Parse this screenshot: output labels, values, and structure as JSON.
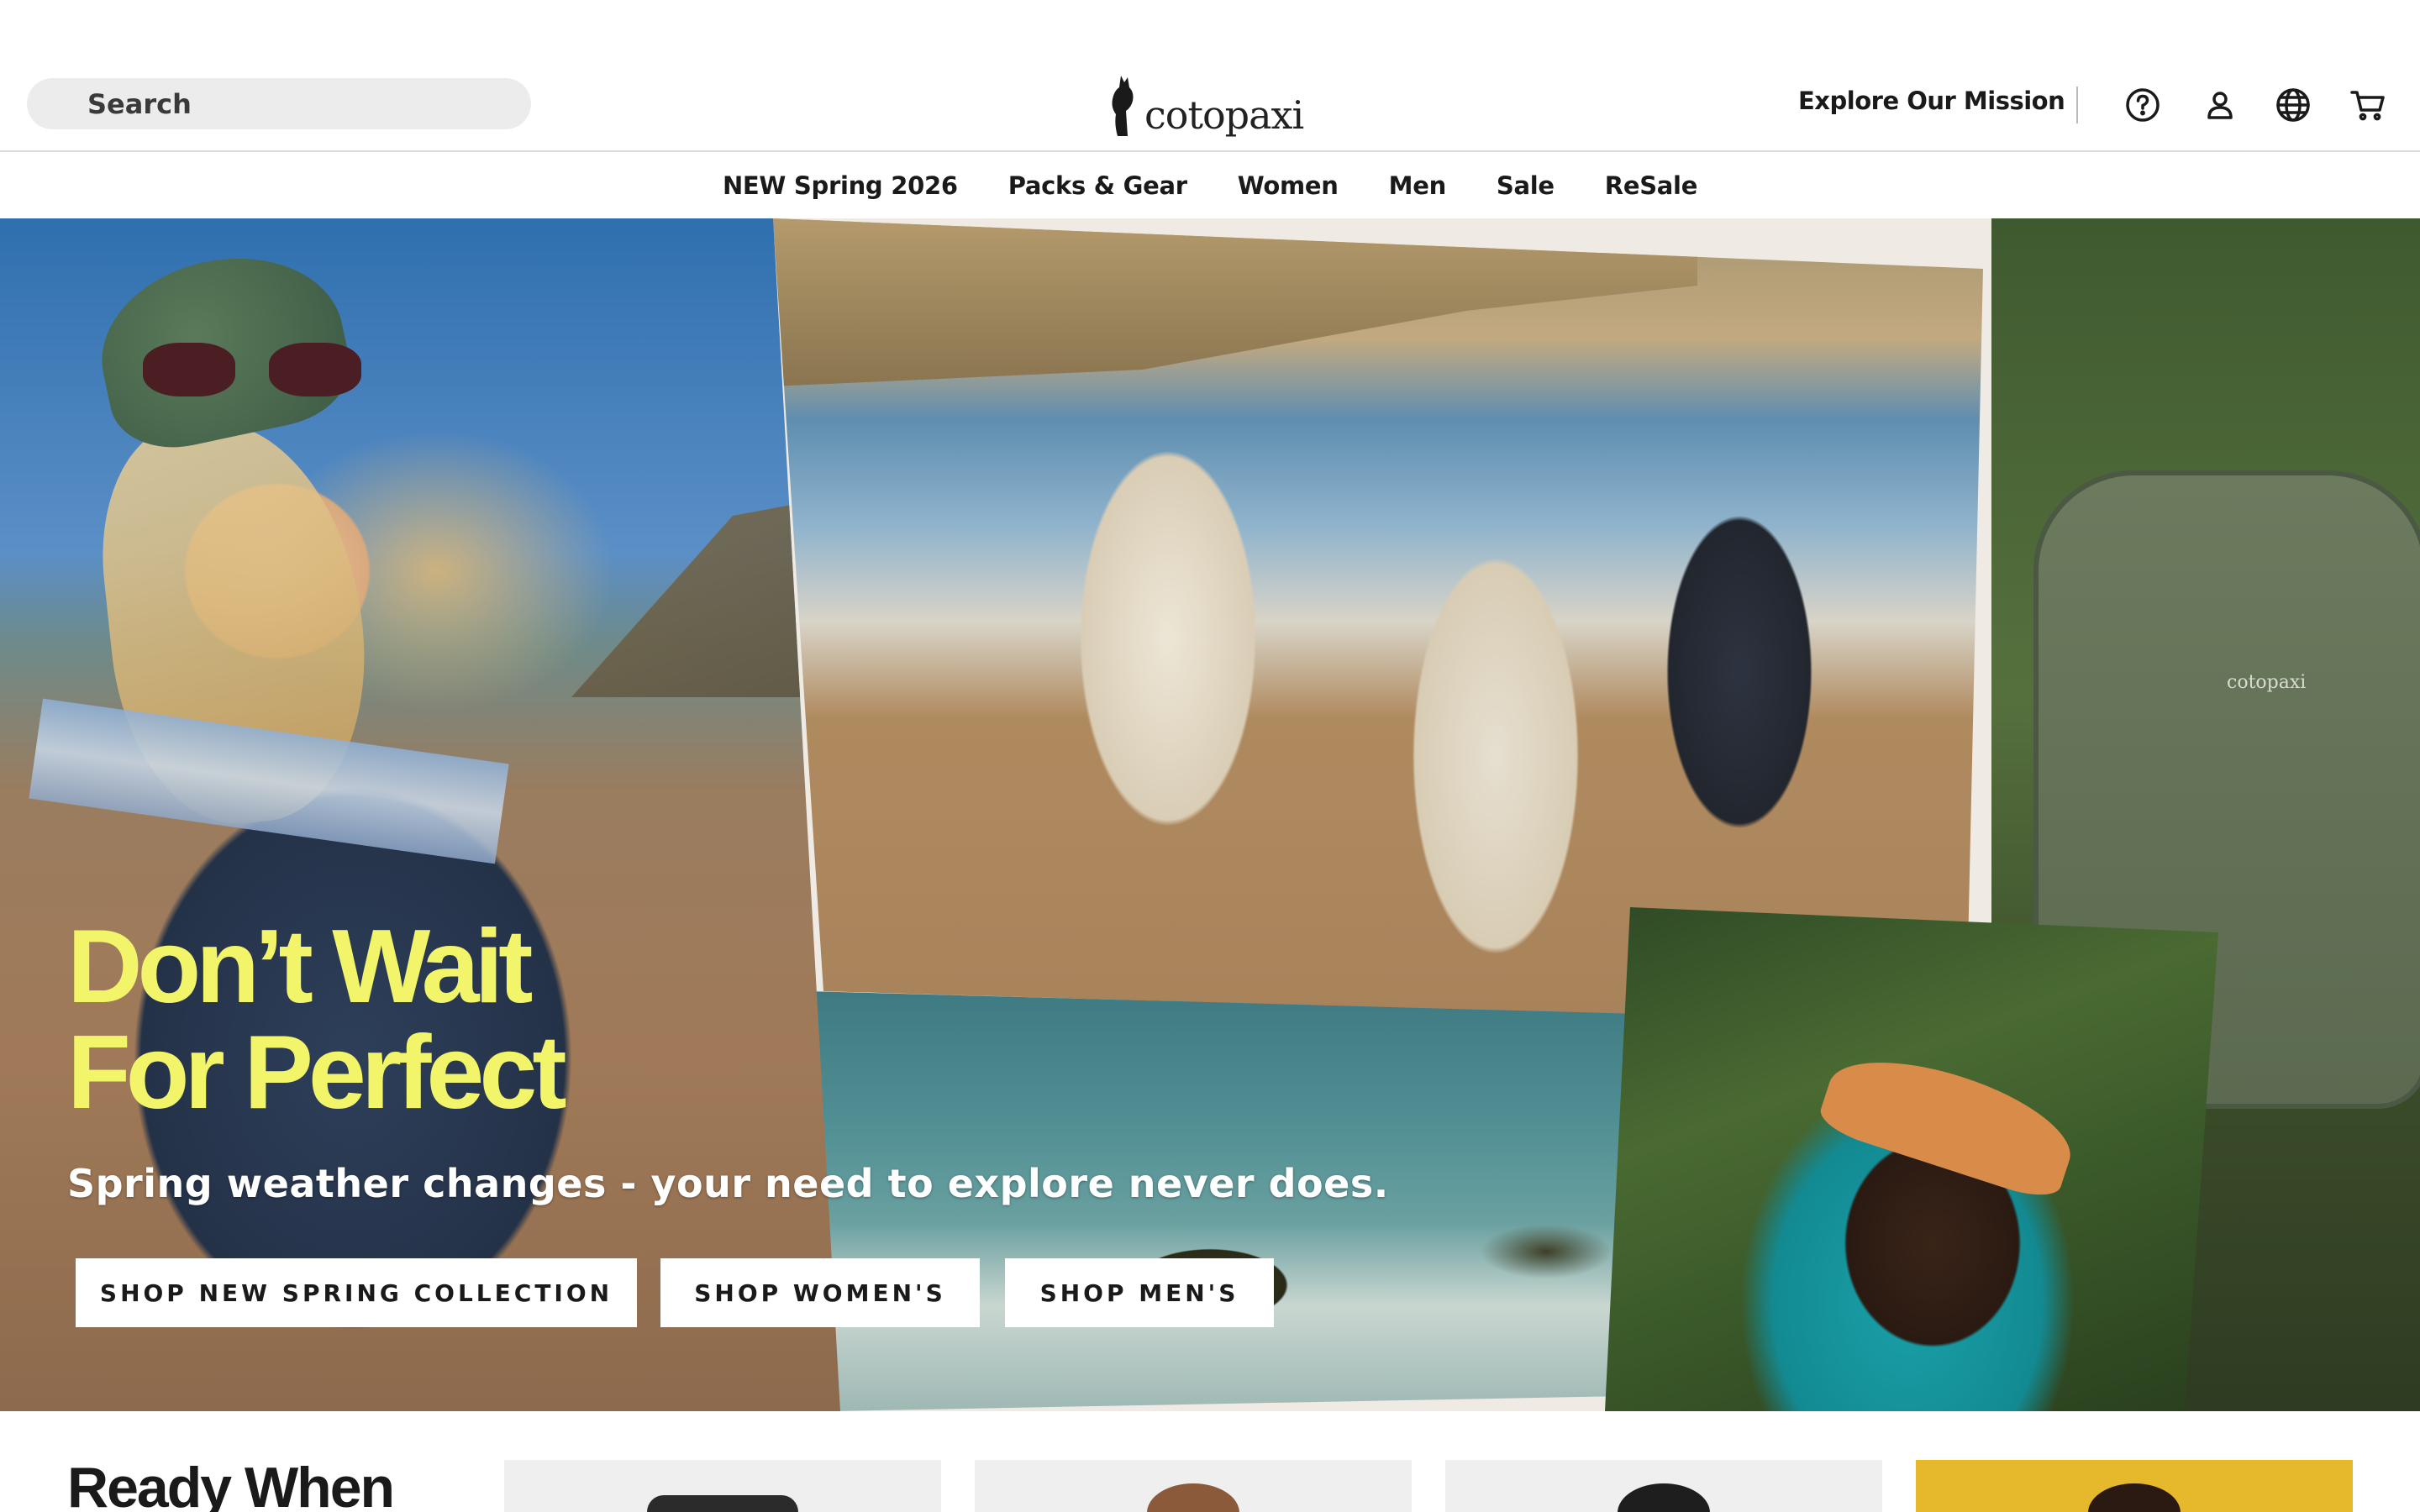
{
  "header": {
    "search_placeholder": "Search",
    "logo_text": "cotopaxi",
    "mission_link": "Explore Our Mission",
    "icons": [
      "help-icon",
      "account-icon",
      "globe-icon",
      "cart-icon"
    ]
  },
  "nav": {
    "items": [
      "NEW Spring 2026",
      "Packs & Gear",
      "Women",
      "Men",
      "Sale",
      "ReSale"
    ]
  },
  "hero": {
    "headline_line1": "Don’t Wait",
    "headline_line2": "For Perfect",
    "subhead": "Spring weather changes - your need to explore never does.",
    "buttons": [
      "SHOP NEW SPRING COLLECTION",
      "SHOP WOMEN'S",
      "SHOP MEN'S"
    ],
    "backpack_logo": "cotopaxi"
  },
  "below": {
    "section_title": "Ready When"
  },
  "colors": {
    "headline": "#f2f56a",
    "accent_card": "#e6b92c"
  }
}
